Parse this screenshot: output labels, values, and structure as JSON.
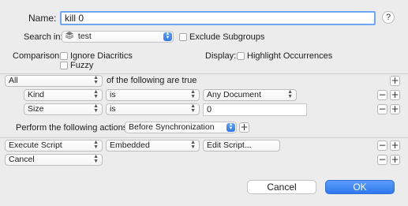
{
  "header": {
    "name_label": "Name:",
    "name_value": "kill 0",
    "help_label": "?",
    "search_in_label": "Search in:",
    "search_in_value": "test",
    "exclude_subgroups_label": "Exclude Subgroups",
    "comparison_label": "Comparison:",
    "ignore_diacritics_label": "Ignore Diacritics",
    "fuzzy_label": "Fuzzy",
    "display_label": "Display:",
    "highlight_occurrences_label": "Highlight Occurrences"
  },
  "conditions": {
    "match_value": "All",
    "match_suffix": "of the following are true",
    "rows": [
      {
        "field": "Kind",
        "operator": "is",
        "value": "Any Document"
      },
      {
        "field": "Size",
        "operator": "is",
        "value": "0"
      }
    ]
  },
  "actions": {
    "perform_label": "Perform the following actions:",
    "timing_value": "Before Synchronization",
    "rows": [
      {
        "action": "Execute Script",
        "script_type": "Embedded",
        "edit_label": "Edit Script..."
      },
      {
        "action": "Cancel"
      }
    ]
  },
  "footer": {
    "cancel_label": "Cancel",
    "ok_label": "OK"
  },
  "icons": {
    "plus": "+",
    "minus": "−",
    "chevron_up": "▲",
    "chevron_down": "▼"
  },
  "colors": {
    "accent": "#2f79ee",
    "ok_button": "#3b82f6"
  }
}
